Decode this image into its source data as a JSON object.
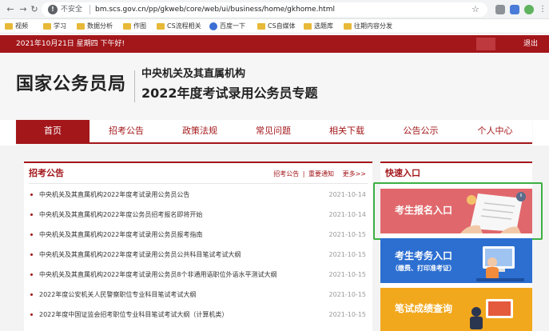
{
  "browser": {
    "security_text": "不安全",
    "url": "bm.scs.gov.cn/pp/gkweb/core/web/ui/business/home/gkhome.html",
    "bookmarks": [
      "视频",
      "学习",
      "数据分析",
      "作图",
      "CS流程相关",
      "百度一下",
      "CS自媒体",
      "选题库",
      "往期内容分发"
    ]
  },
  "top_strip": {
    "date": "2021年10月21日  星期四  下午好!",
    "logout": "退出"
  },
  "header": {
    "site_name": "国家公务员局",
    "subtitle_1": "中央机关及其直属机构",
    "subtitle_2": "2022年度考试录用公务员专题"
  },
  "nav": {
    "items": [
      "首页",
      "招考公告",
      "政策法规",
      "常见问题",
      "相关下载",
      "公告公示",
      "个人中心"
    ]
  },
  "notices": {
    "title": "招考公告",
    "links": [
      "招考公告",
      "|",
      "重要通知",
      "更多>>"
    ],
    "items": [
      {
        "title": "中央机关及其直属机构2022年度考试录用公务员公告",
        "date": "2021-10-14"
      },
      {
        "title": "中央机关及其直属机构2022年度公务员招考报名即将开始",
        "date": "2021-10-14"
      },
      {
        "title": "中央机关及其直属机构2022年度考试录用公务员报考指南",
        "date": "2021-10-15"
      },
      {
        "title": "中央机关及其直属机构2022年度考试录用公务员公共科目笔试考试大纲",
        "date": "2021-10-15"
      },
      {
        "title": "中央机关及其直属机构2022年度考试录用公务员8个非通用语职位外语水平测试大纲",
        "date": "2021-10-15"
      },
      {
        "title": "2022年度公安机关人民警察职位专业科目笔试考试大纲",
        "date": "2021-10-15"
      },
      {
        "title": "2022年度中国证监会招考职位专业科目笔试考试大纲（计算机类）",
        "date": "2021-10-15"
      }
    ]
  },
  "quick": {
    "title": "快速入口",
    "register": "考生报名入口",
    "exam_service": "考生考务入口",
    "exam_service_sub": "（缴费、打印准考证）",
    "score": "笔试成绩查询"
  },
  "colors": {
    "brand_red": "#a3161a",
    "highlight_green": "#3cb043",
    "register_card": "#e0686c",
    "exam_card": "#2c6fd1",
    "score_card": "#f2a81d"
  }
}
